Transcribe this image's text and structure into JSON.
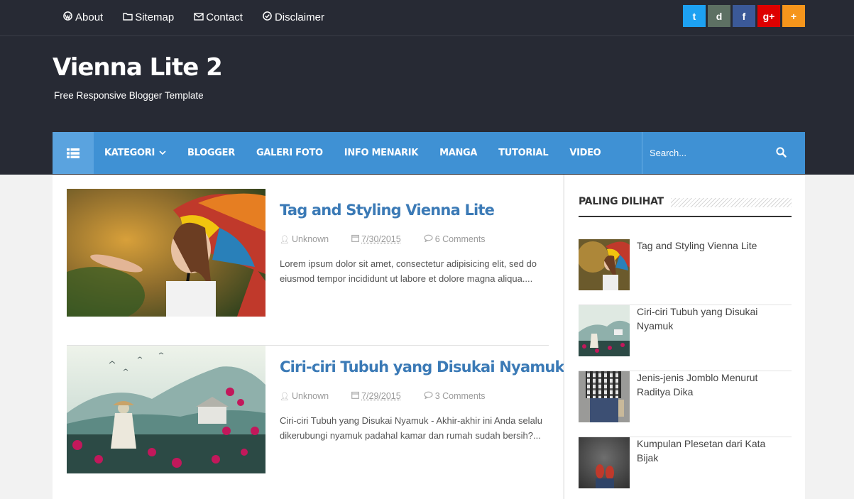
{
  "top_nav": [
    {
      "label": "About",
      "icon": "wordpress-icon"
    },
    {
      "label": "Sitemap",
      "icon": "folder-icon"
    },
    {
      "label": "Contact",
      "icon": "envelope-icon"
    },
    {
      "label": "Disclaimer",
      "icon": "check-circle-icon"
    }
  ],
  "social": [
    {
      "name": "twitter-icon",
      "glyph": "t",
      "color": "#1da1f2"
    },
    {
      "name": "deviantart-icon",
      "glyph": "d",
      "color": "#5d7063"
    },
    {
      "name": "facebook-icon",
      "glyph": "f",
      "color": "#3b5998"
    },
    {
      "name": "google-plus-icon",
      "glyph": "g+",
      "color": "#dd0000"
    },
    {
      "name": "plus-icon",
      "glyph": "+",
      "color": "#f5951c"
    }
  ],
  "site": {
    "title": "Vienna Lite 2",
    "tagline": "Free Responsive Blogger Template"
  },
  "main_nav": {
    "items": [
      "KATEGORI",
      "BLOGGER",
      "GALERI FOTO",
      "INFO MENARIK",
      "MANGA",
      "TUTORIAL",
      "VIDEO"
    ],
    "search_placeholder": "Search...",
    "accent": "#3f91d4"
  },
  "posts": [
    {
      "title": "Tag and Styling Vienna Lite",
      "author": "Unknown",
      "date": "7/30/2015",
      "comments": "6 Comments",
      "excerpt": "Lorem ipsum dolor sit amet, consectetur adipisicing elit, sed do eiusmod tempor incididunt ut labore et dolore magna aliqua...."
    },
    {
      "title": "Ciri-ciri Tubuh yang Disukai Nyamuk",
      "author": "Unknown",
      "date": "7/29/2015",
      "comments": "3 Comments",
      "excerpt": "Ciri-ciri Tubuh yang Disukai Nyamuk - Akhir-akhir ini Anda selalu dikerubungi nyamuk padahal kamar dan rumah sudah bersih?..."
    }
  ],
  "sidebar": {
    "widget_title": "PALING DILIHAT",
    "popular": [
      "Tag and Styling Vienna Lite",
      "Ciri-ciri Tubuh yang Disukai Nyamuk",
      "Jenis-jenis Jomblo Menurut Raditya Dika",
      "Kumpulan Plesetan dari Kata Bijak"
    ]
  }
}
